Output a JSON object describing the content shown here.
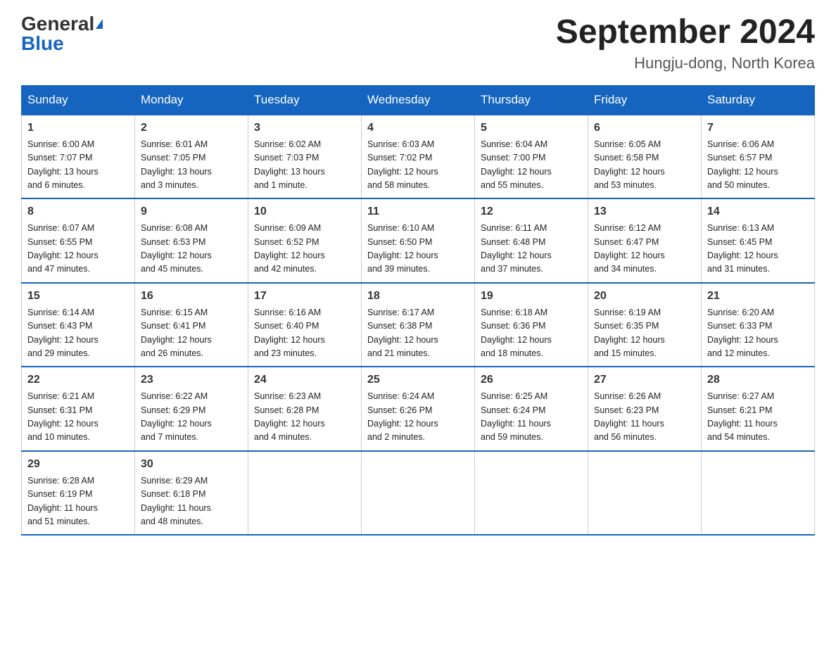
{
  "logo": {
    "general": "General",
    "blue": "Blue"
  },
  "title": "September 2024",
  "subtitle": "Hungju-dong, North Korea",
  "days_of_week": [
    "Sunday",
    "Monday",
    "Tuesday",
    "Wednesday",
    "Thursday",
    "Friday",
    "Saturday"
  ],
  "weeks": [
    [
      {
        "day": "1",
        "info": "Sunrise: 6:00 AM\nSunset: 7:07 PM\nDaylight: 13 hours\nand 6 minutes."
      },
      {
        "day": "2",
        "info": "Sunrise: 6:01 AM\nSunset: 7:05 PM\nDaylight: 13 hours\nand 3 minutes."
      },
      {
        "day": "3",
        "info": "Sunrise: 6:02 AM\nSunset: 7:03 PM\nDaylight: 13 hours\nand 1 minute."
      },
      {
        "day": "4",
        "info": "Sunrise: 6:03 AM\nSunset: 7:02 PM\nDaylight: 12 hours\nand 58 minutes."
      },
      {
        "day": "5",
        "info": "Sunrise: 6:04 AM\nSunset: 7:00 PM\nDaylight: 12 hours\nand 55 minutes."
      },
      {
        "day": "6",
        "info": "Sunrise: 6:05 AM\nSunset: 6:58 PM\nDaylight: 12 hours\nand 53 minutes."
      },
      {
        "day": "7",
        "info": "Sunrise: 6:06 AM\nSunset: 6:57 PM\nDaylight: 12 hours\nand 50 minutes."
      }
    ],
    [
      {
        "day": "8",
        "info": "Sunrise: 6:07 AM\nSunset: 6:55 PM\nDaylight: 12 hours\nand 47 minutes."
      },
      {
        "day": "9",
        "info": "Sunrise: 6:08 AM\nSunset: 6:53 PM\nDaylight: 12 hours\nand 45 minutes."
      },
      {
        "day": "10",
        "info": "Sunrise: 6:09 AM\nSunset: 6:52 PM\nDaylight: 12 hours\nand 42 minutes."
      },
      {
        "day": "11",
        "info": "Sunrise: 6:10 AM\nSunset: 6:50 PM\nDaylight: 12 hours\nand 39 minutes."
      },
      {
        "day": "12",
        "info": "Sunrise: 6:11 AM\nSunset: 6:48 PM\nDaylight: 12 hours\nand 37 minutes."
      },
      {
        "day": "13",
        "info": "Sunrise: 6:12 AM\nSunset: 6:47 PM\nDaylight: 12 hours\nand 34 minutes."
      },
      {
        "day": "14",
        "info": "Sunrise: 6:13 AM\nSunset: 6:45 PM\nDaylight: 12 hours\nand 31 minutes."
      }
    ],
    [
      {
        "day": "15",
        "info": "Sunrise: 6:14 AM\nSunset: 6:43 PM\nDaylight: 12 hours\nand 29 minutes."
      },
      {
        "day": "16",
        "info": "Sunrise: 6:15 AM\nSunset: 6:41 PM\nDaylight: 12 hours\nand 26 minutes."
      },
      {
        "day": "17",
        "info": "Sunrise: 6:16 AM\nSunset: 6:40 PM\nDaylight: 12 hours\nand 23 minutes."
      },
      {
        "day": "18",
        "info": "Sunrise: 6:17 AM\nSunset: 6:38 PM\nDaylight: 12 hours\nand 21 minutes."
      },
      {
        "day": "19",
        "info": "Sunrise: 6:18 AM\nSunset: 6:36 PM\nDaylight: 12 hours\nand 18 minutes."
      },
      {
        "day": "20",
        "info": "Sunrise: 6:19 AM\nSunset: 6:35 PM\nDaylight: 12 hours\nand 15 minutes."
      },
      {
        "day": "21",
        "info": "Sunrise: 6:20 AM\nSunset: 6:33 PM\nDaylight: 12 hours\nand 12 minutes."
      }
    ],
    [
      {
        "day": "22",
        "info": "Sunrise: 6:21 AM\nSunset: 6:31 PM\nDaylight: 12 hours\nand 10 minutes."
      },
      {
        "day": "23",
        "info": "Sunrise: 6:22 AM\nSunset: 6:29 PM\nDaylight: 12 hours\nand 7 minutes."
      },
      {
        "day": "24",
        "info": "Sunrise: 6:23 AM\nSunset: 6:28 PM\nDaylight: 12 hours\nand 4 minutes."
      },
      {
        "day": "25",
        "info": "Sunrise: 6:24 AM\nSunset: 6:26 PM\nDaylight: 12 hours\nand 2 minutes."
      },
      {
        "day": "26",
        "info": "Sunrise: 6:25 AM\nSunset: 6:24 PM\nDaylight: 11 hours\nand 59 minutes."
      },
      {
        "day": "27",
        "info": "Sunrise: 6:26 AM\nSunset: 6:23 PM\nDaylight: 11 hours\nand 56 minutes."
      },
      {
        "day": "28",
        "info": "Sunrise: 6:27 AM\nSunset: 6:21 PM\nDaylight: 11 hours\nand 54 minutes."
      }
    ],
    [
      {
        "day": "29",
        "info": "Sunrise: 6:28 AM\nSunset: 6:19 PM\nDaylight: 11 hours\nand 51 minutes."
      },
      {
        "day": "30",
        "info": "Sunrise: 6:29 AM\nSunset: 6:18 PM\nDaylight: 11 hours\nand 48 minutes."
      },
      {
        "day": "",
        "info": ""
      },
      {
        "day": "",
        "info": ""
      },
      {
        "day": "",
        "info": ""
      },
      {
        "day": "",
        "info": ""
      },
      {
        "day": "",
        "info": ""
      }
    ]
  ]
}
